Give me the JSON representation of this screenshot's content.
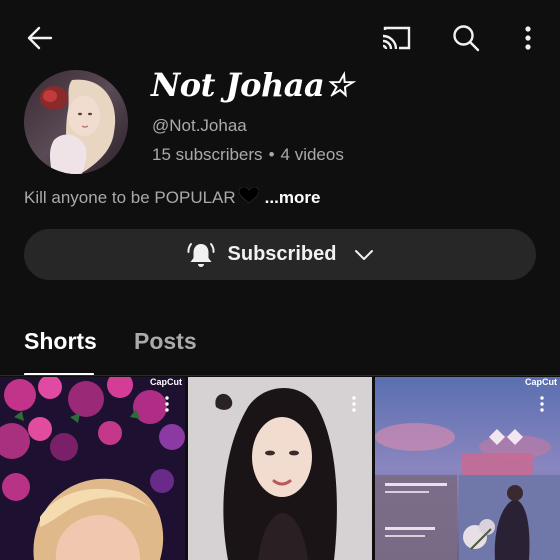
{
  "header": {
    "icons": [
      "back-arrow-icon",
      "cast-icon",
      "search-icon",
      "more-vertical-icon"
    ]
  },
  "channel": {
    "name": "Not Johaa☆",
    "handle": "@Not.Johaa",
    "subscribers": "15 subscribers",
    "separator": "•",
    "videos": "4 videos",
    "bio_text": "Kill anyone to be POPULAR",
    "bio_more": "...more"
  },
  "subscribe_button": {
    "label": "Subscribed",
    "icons": [
      "bell-icon",
      "chevron-down-icon"
    ]
  },
  "tabs": [
    {
      "label": "Shorts",
      "selected": true
    },
    {
      "label": "Posts",
      "selected": false
    }
  ],
  "shorts": [
    {
      "watermark": "CapCut"
    },
    {
      "watermark": ""
    },
    {
      "watermark": "CapCut"
    }
  ],
  "colors": {
    "background": "#0f0f0f",
    "button_bg": "#272727",
    "secondary_text": "#aaaaaa",
    "primary_text": "#f1f1f1"
  }
}
